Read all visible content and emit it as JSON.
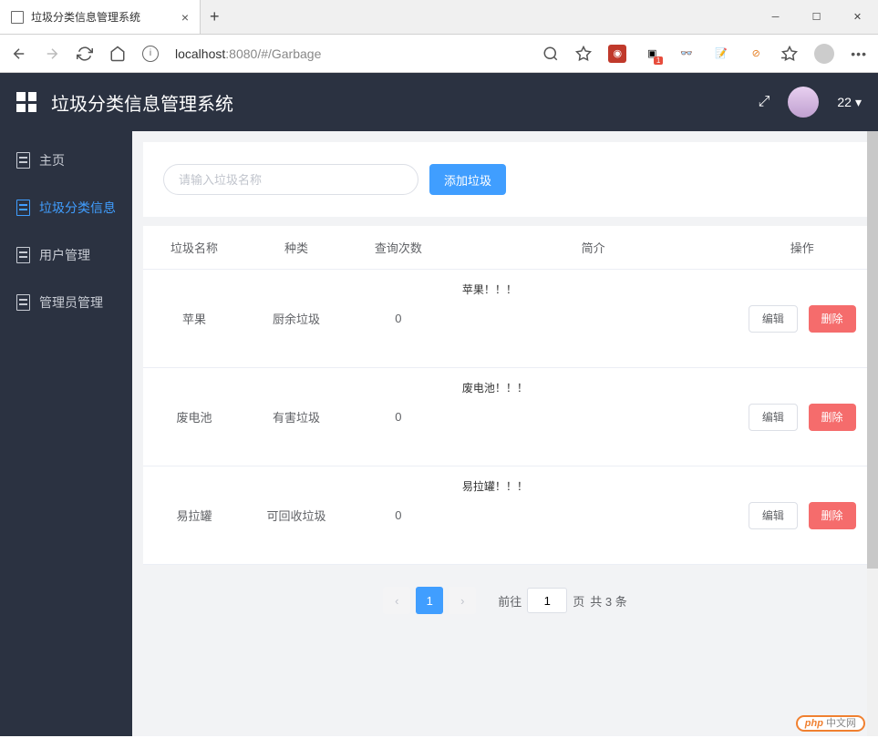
{
  "browser": {
    "tab_title": "垃圾分类信息管理系统",
    "url_host": "localhost",
    "url_port": ":8080",
    "url_path": "/#/Garbage"
  },
  "header": {
    "app_title": "垃圾分类信息管理系统",
    "user_badge": "22"
  },
  "sidebar": {
    "items": [
      {
        "label": "主页",
        "active": false
      },
      {
        "label": "垃圾分类信息",
        "active": true
      },
      {
        "label": "用户管理",
        "active": false
      },
      {
        "label": "管理员管理",
        "active": false
      }
    ]
  },
  "search": {
    "placeholder": "请输入垃圾名称",
    "add_label": "添加垃圾"
  },
  "table": {
    "headers": {
      "name": "垃圾名称",
      "type": "种类",
      "count": "查询次数",
      "desc": "简介",
      "action": "操作"
    },
    "action_edit": "编辑",
    "action_delete": "删除",
    "rows": [
      {
        "name": "苹果",
        "type": "厨余垃圾",
        "count": "0",
        "desc": "苹果！！！"
      },
      {
        "name": "废电池",
        "type": "有害垃圾",
        "count": "0",
        "desc": "废电池！！！"
      },
      {
        "name": "易拉罐",
        "type": "可回收垃圾",
        "count": "0",
        "desc": "易拉罐！！！"
      }
    ]
  },
  "pagination": {
    "current": "1",
    "goto_prefix": "前往",
    "goto_value": "1",
    "goto_suffix": "页",
    "total_text": "共 3 条"
  },
  "watermark": {
    "brand": "php",
    "suffix": "中文网"
  }
}
